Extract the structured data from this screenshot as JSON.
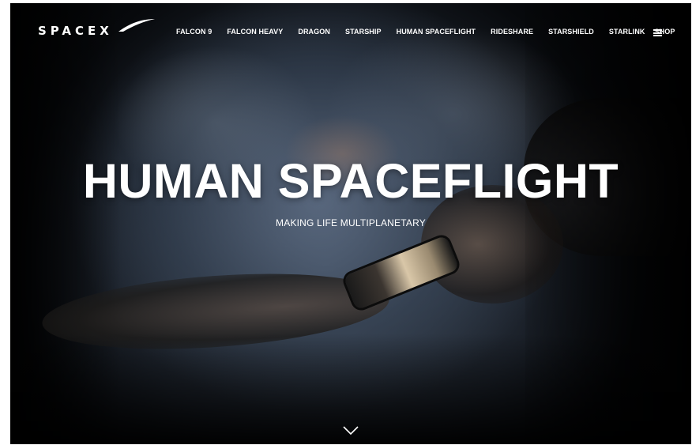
{
  "brand": {
    "logo_text": "SPACEX"
  },
  "nav": {
    "items": [
      {
        "label": "FALCON 9"
      },
      {
        "label": "FALCON HEAVY"
      },
      {
        "label": "DRAGON"
      },
      {
        "label": "STARSHIP"
      },
      {
        "label": "HUMAN SPACEFLIGHT"
      },
      {
        "label": "RIDESHARE"
      },
      {
        "label": "STARSHIELD"
      },
      {
        "label": "STARLINK"
      },
      {
        "label": "SHOP"
      }
    ],
    "menu_icon": "hamburger-menu-icon"
  },
  "hero": {
    "title": "HUMAN SPACEFLIGHT",
    "subtitle": "MAKING LIFE MULTIPLANETARY",
    "scroll_icon": "chevron-down-icon"
  },
  "colors": {
    "text": "#ffffff",
    "background": "#000000"
  }
}
